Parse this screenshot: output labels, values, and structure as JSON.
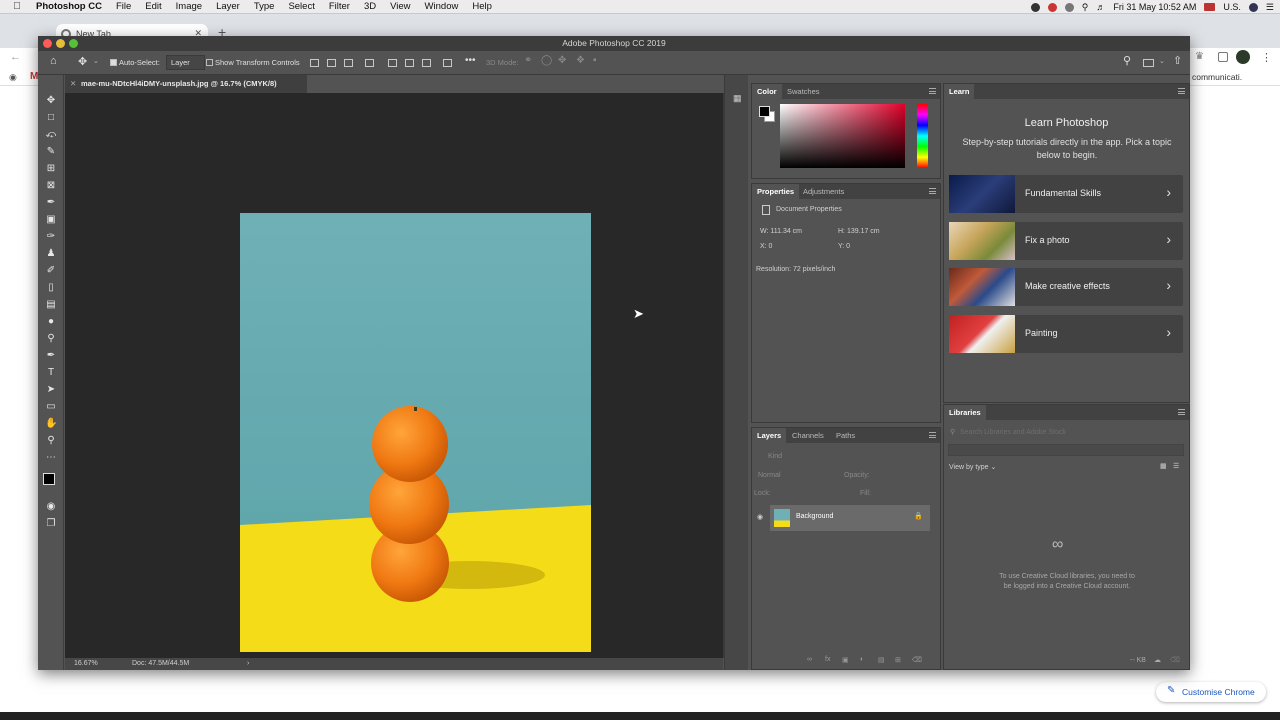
{
  "mac_menubar": {
    "app_name": "Photoshop CC",
    "menus": [
      "File",
      "Edit",
      "Image",
      "Layer",
      "Type",
      "Select",
      "Filter",
      "3D",
      "View",
      "Window",
      "Help"
    ],
    "clock": "Fri 31 May  10:52 AM",
    "input_source": "U.S."
  },
  "chrome": {
    "tab_title": "New Tab",
    "bookmark_fragment": "communicati...",
    "customize_label": "Customise Chrome"
  },
  "photoshop": {
    "window_title": "Adobe Photoshop CC 2019",
    "options": {
      "auto_select_label": "Auto-Select:",
      "auto_select_value": "Layer",
      "transform_controls_label": "Show Transform Controls",
      "mode_3d_label": "3D Mode:"
    },
    "doc_tab_title": "mae-mu-NDtcHl4iDMY-unsplash.jpg @ 16.7% (CMYK/8)",
    "status": {
      "zoom": "16.67%",
      "doc_size": "Doc: 47.5M/44.5M"
    },
    "color_panel": {
      "tabs": [
        "Color",
        "Swatches"
      ]
    },
    "properties_panel": {
      "tabs": [
        "Properties",
        "Adjustments"
      ],
      "section_title": "Document Properties",
      "width": "W: 111.34 cm",
      "height": "H: 139.17 cm",
      "x": "X: 0",
      "y": "Y: 0",
      "resolution": "Resolution: 72 pixels/inch"
    },
    "layers_panel": {
      "tabs": [
        "Layers",
        "Channels",
        "Paths"
      ],
      "kind_placeholder": "Kind",
      "blend_mode": "Normal",
      "opacity_label": "Opacity:",
      "lock_label": "Lock:",
      "fill_label": "Fill:",
      "layer_name": "Background"
    },
    "learn_panel": {
      "tab": "Learn",
      "heading": "Learn Photoshop",
      "description": "Step-by-step tutorials directly in the app. Pick a topic below to begin.",
      "topics": [
        "Fundamental Skills",
        "Fix a photo",
        "Make creative effects",
        "Painting"
      ]
    },
    "libraries_panel": {
      "tab": "Libraries",
      "search_placeholder": "Search Libraries and Adobe Stock",
      "view_by_label": "View by type",
      "login_message": "To use Creative Cloud libraries, you need to be logged into a Creative Cloud account.",
      "storage_label": "-- KB"
    }
  }
}
